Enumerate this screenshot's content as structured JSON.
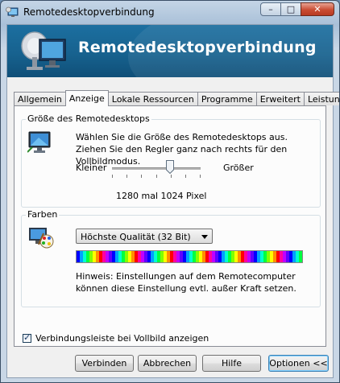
{
  "window": {
    "title": "Remotedesktopverbindung",
    "controls": {
      "minimize": "–",
      "maximize": "□",
      "close": "✕"
    }
  },
  "banner": {
    "title": "Remotedesktopverbindung"
  },
  "tabs": [
    {
      "label": "Allgemein",
      "active": false
    },
    {
      "label": "Anzeige",
      "active": true
    },
    {
      "label": "Lokale Ressourcen",
      "active": false
    },
    {
      "label": "Programme",
      "active": false
    },
    {
      "label": "Erweitert",
      "active": false
    },
    {
      "label": "Leistung",
      "active": false
    }
  ],
  "display_size": {
    "group_label": "Größe des Remotedesktops",
    "description": "Wählen Sie die Größe des Remotedesktops aus. Ziehen Sie den Regler ganz nach rechts für den Vollbildmodus.",
    "slider_min_label": "Kleiner",
    "slider_max_label": "Größer",
    "slider_level_fraction": 0.65,
    "resolution_text": "1280 mal 1024 Pixel",
    "icon": "monitor-icon"
  },
  "colors": {
    "group_label": "Farben",
    "selected_option": "Höchste Qualität (32 Bit)",
    "hint": "Hinweis: Einstellungen auf dem Remotecomputer können diese Einstellung evtl. außer Kraft setzen.",
    "icon": "color-palette-icon"
  },
  "connection_bar": {
    "label": "Verbindungsleiste bei Vollbild anzeigen",
    "checked": true
  },
  "buttons": {
    "connect": "Verbinden",
    "cancel": "Abbrechen",
    "help": "Hilfe",
    "options": "Optionen <<"
  },
  "accent_colors": {
    "banner": "#17628f",
    "window_frame": "#a9c0d8",
    "close_button": "#c94c33"
  }
}
